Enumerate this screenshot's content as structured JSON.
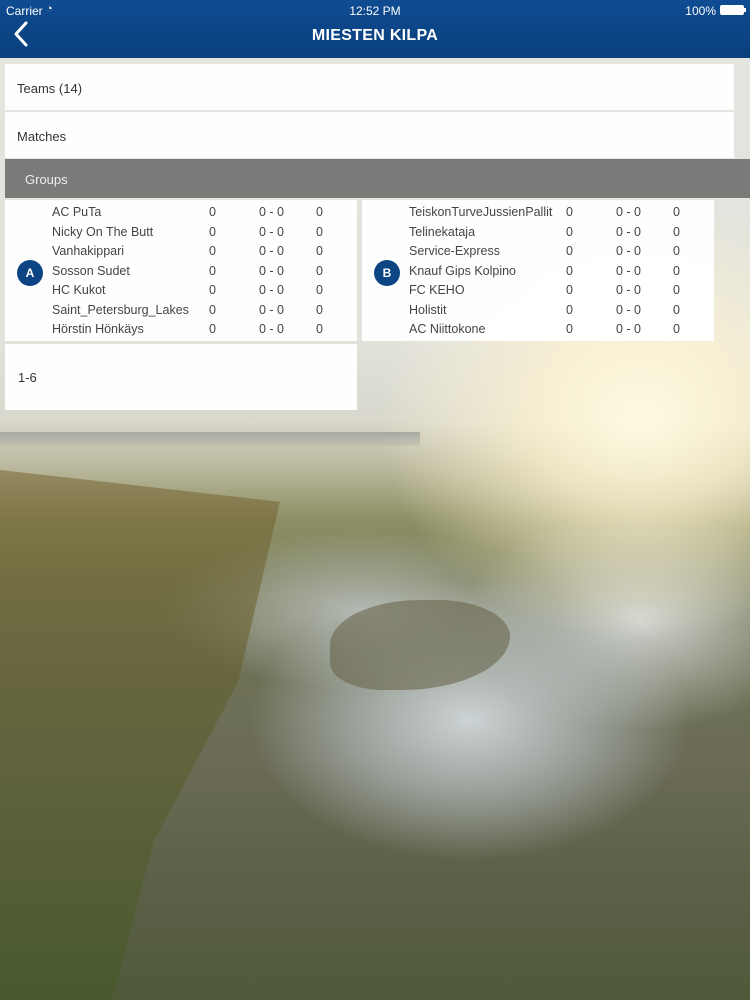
{
  "status_bar": {
    "carrier": "Carrier",
    "time": "12:52 PM",
    "battery": "100%"
  },
  "nav": {
    "title": "MIESTEN KILPA",
    "back_icon": "chevron-left-icon"
  },
  "menu": {
    "teams_label": "Teams (14)",
    "matches_label": "Matches",
    "groups_label": "Groups"
  },
  "groups": [
    {
      "badge": "A",
      "rows": [
        {
          "name": "AC PuTa",
          "played": "0",
          "score": "0 - 0",
          "points": "0"
        },
        {
          "name": "Nicky On The Butt",
          "played": "0",
          "score": "0 - 0",
          "points": "0"
        },
        {
          "name": "Vanhakippari",
          "played": "0",
          "score": "0 - 0",
          "points": "0"
        },
        {
          "name": "Sosson Sudet",
          "played": "0",
          "score": "0 - 0",
          "points": "0"
        },
        {
          "name": "HC Kukot",
          "played": "0",
          "score": "0 - 0",
          "points": "0"
        },
        {
          "name": "Saint_Petersburg_Lakes",
          "played": "0",
          "score": "0 - 0",
          "points": "0"
        },
        {
          "name": "Hörstin Hönkäys",
          "played": "0",
          "score": "0 - 0",
          "points": "0"
        }
      ]
    },
    {
      "badge": "B",
      "rows": [
        {
          "name": "TeiskonTurveJussienPallit",
          "played": "0",
          "score": "0 - 0",
          "points": "0"
        },
        {
          "name": "Telinekataja",
          "played": "0",
          "score": "0 - 0",
          "points": "0"
        },
        {
          "name": "Service-Express",
          "played": "0",
          "score": "0 - 0",
          "points": "0"
        },
        {
          "name": "Knauf Gips Kolpino",
          "played": "0",
          "score": "0 - 0",
          "points": "0"
        },
        {
          "name": "FC KEHO",
          "played": "0",
          "score": "0 - 0",
          "points": "0"
        },
        {
          "name": "Holistit",
          "played": "0",
          "score": "0 - 0",
          "points": "0"
        },
        {
          "name": "AC Niittokone",
          "played": "0",
          "score": "0 - 0",
          "points": "0"
        }
      ]
    }
  ],
  "range_label": "1-6"
}
